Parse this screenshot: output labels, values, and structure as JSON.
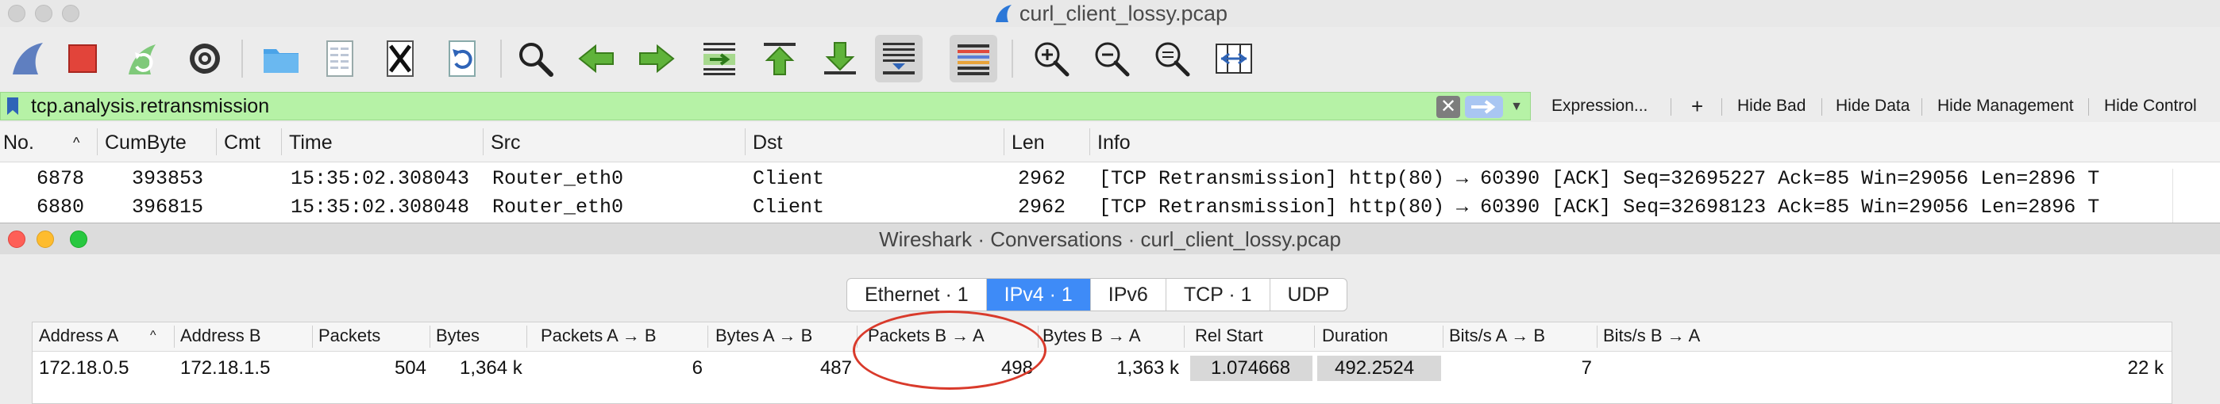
{
  "window": {
    "title": "curl_client_lossy.pcap"
  },
  "toolbar": {
    "icons": [
      "shark-fin-icon",
      "stop-icon",
      "restart-icon",
      "gear-icon",
      "open-folder-icon",
      "open-file-icon",
      "close-file-icon",
      "reload-icon",
      "search-icon",
      "go-back-icon",
      "go-forward-icon",
      "go-to-packet-icon",
      "first-packet-icon",
      "last-packet-icon",
      "autoscroll-icon",
      "colorize-icon",
      "zoom-in-icon",
      "zoom-out-icon",
      "zoom-normal-icon",
      "resize-columns-icon"
    ]
  },
  "filter": {
    "value": "tcp.analysis.retransmission",
    "clear_glyph": "✕",
    "buttons": [
      "Expression...",
      "+",
      "Hide Bad",
      "Hide Data",
      "Hide Management",
      "Hide Control"
    ]
  },
  "packet_list": {
    "columns": [
      "No.",
      "CumByte",
      "Cmt",
      "Time",
      "Src",
      "Dst",
      "Len",
      "Info"
    ],
    "sort_glyph": "^",
    "rows": [
      {
        "no": "6878",
        "cumbyte": "393853",
        "cmt": "",
        "time": "15:35:02.308043",
        "src": "Router_eth0",
        "dst": "Client",
        "len": "2962",
        "info": "[TCP Retransmission] http(80) → 60390 [ACK] Seq=32695227 Ack=85 Win=29056 Len=2896 T"
      },
      {
        "no": "6880",
        "cumbyte": "396815",
        "cmt": "",
        "time": "15:35:02.308048",
        "src": "Router_eth0",
        "dst": "Client",
        "len": "2962",
        "info": "[TCP Retransmission] http(80) → 60390 [ACK] Seq=32698123 Ack=85 Win=29056 Len=2896 T"
      }
    ]
  },
  "conversations": {
    "title": "Wireshark · Conversations · curl_client_lossy.pcap",
    "tabs": [
      "Ethernet · 1",
      "IPv4 · 1",
      "IPv6",
      "TCP · 1",
      "UDP"
    ],
    "selected_tab": "IPv4 · 1",
    "columns": [
      "Address A",
      "Address B",
      "Packets",
      "Bytes",
      "Packets A → B",
      "Bytes A → B",
      "Packets B → A",
      "Bytes B → A",
      "Rel Start",
      "Duration",
      "Bits/s A → B",
      "Bits/s B → A"
    ],
    "sort_glyph": "^",
    "rows": [
      {
        "address_a": "172.18.0.5",
        "address_b": "172.18.1.5",
        "packets": "504",
        "bytes": "1,364 k",
        "packets_a_b": "6",
        "bytes_a_b": "487",
        "packets_b_a": "498",
        "bytes_b_a": "1,363 k",
        "rel_start": "1.074668",
        "duration": "492.2524",
        "bits_a_b": "7",
        "bits_b_a": "22 k"
      }
    ]
  },
  "colors": {
    "filter_valid": "#b6f2a6",
    "selected_tab": "#3e8bf7",
    "annotation": "#d93a2b",
    "close": "#fe5f57",
    "minimize": "#febc2e",
    "zoom": "#28c840"
  }
}
